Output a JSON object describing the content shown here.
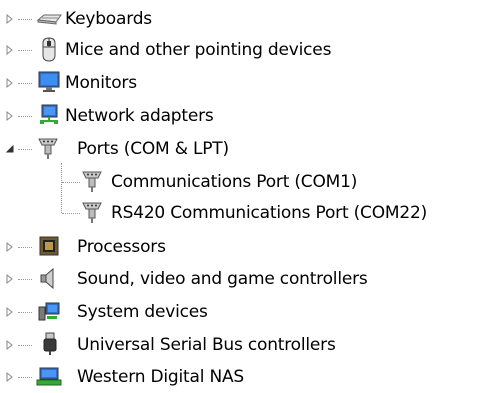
{
  "tree": {
    "items": [
      {
        "label": "Keyboards",
        "icon": "keyboard-icon",
        "expanded": false
      },
      {
        "label": "Mice and other pointing devices",
        "icon": "mouse-icon",
        "expanded": false
      },
      {
        "label": "Monitors",
        "icon": "monitor-icon",
        "expanded": false
      },
      {
        "label": "Network adapters",
        "icon": "network-adapter-icon",
        "expanded": false
      },
      {
        "label": "Ports (COM & LPT)",
        "icon": "port-icon",
        "expanded": true,
        "children": [
          {
            "label": "Communications Port (COM1)",
            "icon": "port-icon"
          },
          {
            "label": "RS420 Communications Port (COM22)",
            "icon": "port-icon"
          }
        ]
      },
      {
        "label": "Processors",
        "icon": "processor-icon",
        "expanded": false
      },
      {
        "label": "Sound, video and game controllers",
        "icon": "speaker-icon",
        "expanded": false
      },
      {
        "label": "System devices",
        "icon": "system-devices-icon",
        "expanded": false
      },
      {
        "label": "Universal Serial Bus controllers",
        "icon": "usb-icon",
        "expanded": false
      },
      {
        "label": "Western Digital NAS",
        "icon": "nas-icon",
        "expanded": false
      }
    ]
  }
}
